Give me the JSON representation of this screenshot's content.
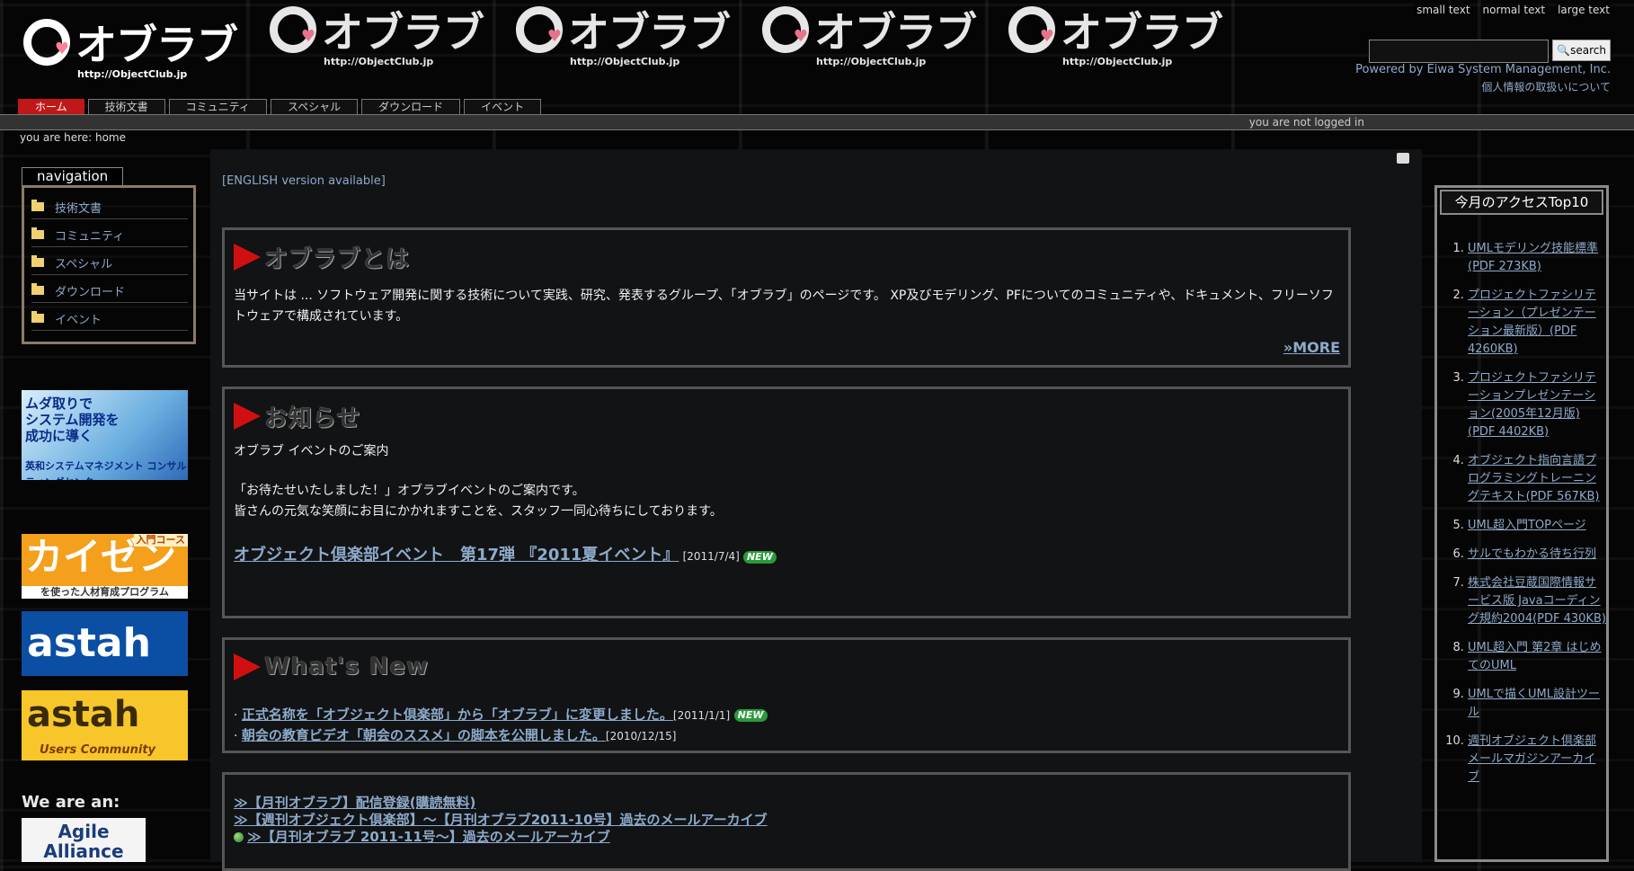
{
  "site": {
    "logo_text": "オブラブ",
    "logo_url": "http://ObjectClub.jp"
  },
  "header": {
    "tools": [
      "small text",
      "normal text",
      "large text"
    ],
    "search_button": "search",
    "search_placeholder": "",
    "powered_by": "Powered by Eiwa System Management, Inc.",
    "privacy": "個人情報の取扱いについて"
  },
  "tabs": [
    {
      "label": "ホーム",
      "active": true
    },
    {
      "label": "技術文書",
      "active": false
    },
    {
      "label": "コミュニティ",
      "active": false
    },
    {
      "label": "スペシャル",
      "active": false
    },
    {
      "label": "ダウンロード",
      "active": false
    },
    {
      "label": "イベント",
      "active": false
    }
  ],
  "status": {
    "login": "you are not logged in",
    "breadcrumb": "you are here: home"
  },
  "navigation": {
    "title": "navigation",
    "items": [
      "技術文書",
      "コミュニティ",
      "スペシャル",
      "ダウンロード",
      "イベント"
    ]
  },
  "banners": {
    "b1_line1": "ムダ取りで",
    "b1_line2": "システム開発を",
    "b1_line3": "成功に導く",
    "b1_company": "英和システムマネジメント コンサルティングセンター",
    "b2_tag": "入門コース",
    "b2_main": "カイゼン",
    "b2_sub": "を使った人材育成プログラム",
    "b3_main": "astah",
    "b4_main": "astah",
    "b4_sub": "Users Community",
    "we_are": "We are an:",
    "b5_main": "Agile Alliance"
  },
  "main": {
    "english": "[ENGLISH version available]",
    "about": {
      "title": "オブラブとは",
      "text": "当サイトは ... ソフトウェア開発に関する技術について実践、研究、発表するグループ、「オブラブ」のページです。 XP及びモデリング、PFについてのコミュニティや、ドキュメント、フリーソフトウェアで構成されています。",
      "more": "MORE"
    },
    "notice": {
      "title": "お知らせ",
      "line1": "オブラブ イベントのご案内",
      "line2": "「お待たせいたしました！」オブラブイベントのご案内です。",
      "line3": "皆さんの元気な笑顔にお目にかかれますことを、スタッフ一同心待ちにしております。",
      "event_link": "オブジェクト倶楽部イベント　第17弾 『2011夏イベント』",
      "event_date": "[2011/7/4]",
      "new_badge": "NEW"
    },
    "whatsnew": {
      "title": "What's New",
      "items": [
        {
          "text": "正式名称を「オブジェクト倶楽部」から「オブラブ」に変更しました。",
          "date": "[2011/1/1]",
          "new": "NEW"
        },
        {
          "text": "朝会の教育ビデオ「朝会のススメ」の脚本を公開しました。",
          "date": "[2010/12/15]",
          "new": ""
        }
      ]
    },
    "archive": {
      "items": [
        "≫【月刊オブラブ】配信登録(購読無料)",
        "≫【週刊オブジェクト倶楽部】～【月刊オブラブ2011-10号】過去のメールアーカイブ",
        "≫【月刊オブラブ 2011-11号～】過去のメールアーカイブ"
      ]
    }
  },
  "top10": {
    "title": "今月のアクセスTop10",
    "items": [
      "UMLモデリング技能標準(PDF 273KB)",
      "プロジェクトファシリテーション（プレゼンテーション最新版）(PDF 4260KB)",
      "プロジェクトファシリテーションプレゼンテーション(2005年12月版)(PDF 4402KB)",
      "オブジェクト指向言語プログラミングトレーニングテキスト(PDF 567KB)",
      "UML超入門TOPページ",
      "サルでもわかる待ち行列",
      "株式会社豆蔵国際情報サービス版 Javaコーディング規約2004(PDF 430KB)",
      "UML超入門 第2章 はじめてのUML",
      "UMLで描くUML設計ツール",
      "週刊オブジェクト倶楽部メールマガジンアーカイブ"
    ]
  }
}
